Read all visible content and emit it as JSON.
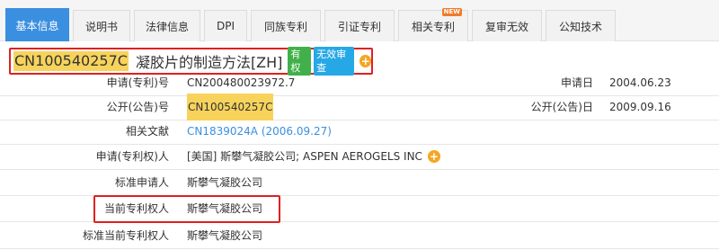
{
  "tabs": [
    {
      "label": "基本信息"
    },
    {
      "label": "说明书"
    },
    {
      "label": "法律信息"
    },
    {
      "label": "DPI"
    },
    {
      "label": "同族专利"
    },
    {
      "label": "引证专利"
    },
    {
      "label": "相关专利",
      "badge": "NEW"
    },
    {
      "label": "复审无效"
    },
    {
      "label": "公知技术"
    }
  ],
  "title": {
    "patent_number": "CN100540257C",
    "name": "凝胶片的制造方法[ZH]",
    "badge_valid": "有权",
    "badge_review": "无效审查",
    "plus_icon": "plus-circle-icon"
  },
  "rows": {
    "application_no": {
      "label": "申请(专利)号",
      "value": "CN200480023972.7"
    },
    "application_date": {
      "label": "申请日",
      "value": "2004.06.23"
    },
    "publication_no": {
      "label": "公开(公告)号",
      "value": "CN100540257C"
    },
    "publication_date": {
      "label": "公开(公告)日",
      "value": "2009.09.16"
    },
    "related_doc": {
      "label": "相关文献",
      "value": "CN1839024A (2006.09.27)"
    },
    "applicant": {
      "label": "申请(专利权)人",
      "value": "[美国] 斯攀气凝胶公司; ASPEN AEROGELS INC"
    },
    "std_applicant": {
      "label": "标准申请人",
      "value": "斯攀气凝胶公司"
    },
    "current_holder": {
      "label": "当前专利权人",
      "value": "斯攀气凝胶公司"
    },
    "std_current_holder": {
      "label": "标准当前专利权人",
      "value": "斯攀气凝胶公司"
    }
  },
  "colors": {
    "tab_active": "#3a8fe0",
    "highlight": "#f7d35c",
    "red_box": "#e02020",
    "badge_green": "#42b04a",
    "badge_blue": "#27a8e6",
    "plus_orange": "#f5a623"
  }
}
